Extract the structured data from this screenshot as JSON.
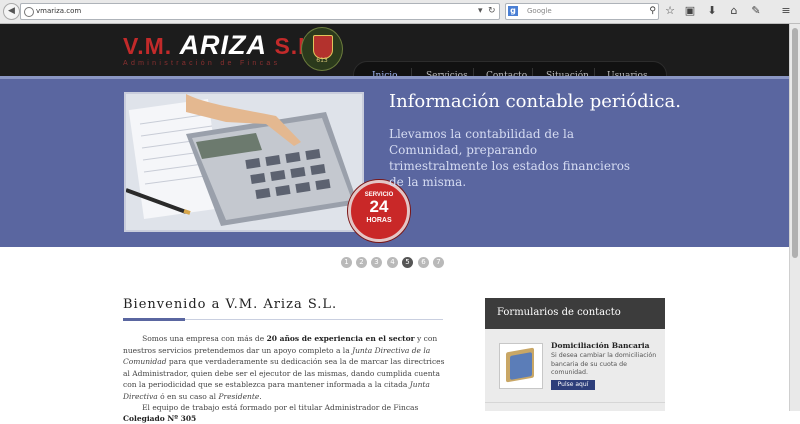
{
  "browser": {
    "url": "vmariza.com",
    "search_engine_glyph": "g",
    "search_placeholder": "Google",
    "icons": [
      "back-icon",
      "globe-icon",
      "dropdown-arrow-icon",
      "reload-icon",
      "binoculars-icon",
      "star-icon",
      "clipboard-icon",
      "download-icon",
      "home-icon",
      "chat-icon",
      "menu-icon"
    ]
  },
  "header": {
    "logo_prefix": "V.M. ",
    "logo_name": "ARIZA",
    "logo_suffix": " S.L.",
    "logo_subtitle": "Administración de Fincas",
    "seal_number": "613",
    "nav": [
      {
        "label": "Inicio",
        "active": true
      },
      {
        "label": "Servicios"
      },
      {
        "label": "Contacto"
      },
      {
        "label": "Situación"
      },
      {
        "label": "Usuarios"
      }
    ]
  },
  "hero": {
    "title": "Información contable periódica.",
    "text": "Llevamos la contabilidad de la Comunidad, preparando trimestralmente los estados financieros de la misma.",
    "badge_top": "SERVICIO",
    "badge_hours": "24",
    "badge_bottom": "HORAS"
  },
  "slider": {
    "dots": [
      "1",
      "2",
      "3",
      "4",
      "5",
      "6",
      "7"
    ],
    "active_index": 4
  },
  "main": {
    "welcome_title": "Bienvenido a V.M. Ariza S.L.",
    "p1": {
      "a": "Somos una empresa con más de ",
      "b": "20 años de experiencia en el sector",
      "c": " y con nuestros servicios pretendemos dar un apoyo completo a la ",
      "d": "Junta Directiva de la Comunidad",
      "e": " para que verdaderamente su dedicación sea la de marcar las directrices al Administrador, quien debe ser el ejecutor de las mismas, dando cumplida cuenta con la periodicidad que se establezca para mantener informada a la citada ",
      "f": "Junta Directiva",
      "g": " ó en su caso al ",
      "h": "Presidente",
      "i": "."
    },
    "p2": {
      "a": "El equipo de trabajo está formado por el titular Administrador de Fincas ",
      "b": "Colegiado Nº 305"
    }
  },
  "sidebar": {
    "title": "Formularios de contacto",
    "item_title": "Domiciliación Bancaria",
    "item_text": "Si desea cambiar la domiciliación bancaria de su cuota de comunidad.",
    "item_button": "Pulse aquí"
  },
  "colors": {
    "header_bg": "#1c1c1c",
    "hero_bg": "#5a66a0",
    "logo_red": "#c22a2a",
    "nav_active": "#9fb4ee",
    "button_blue": "#2d3e7a"
  }
}
